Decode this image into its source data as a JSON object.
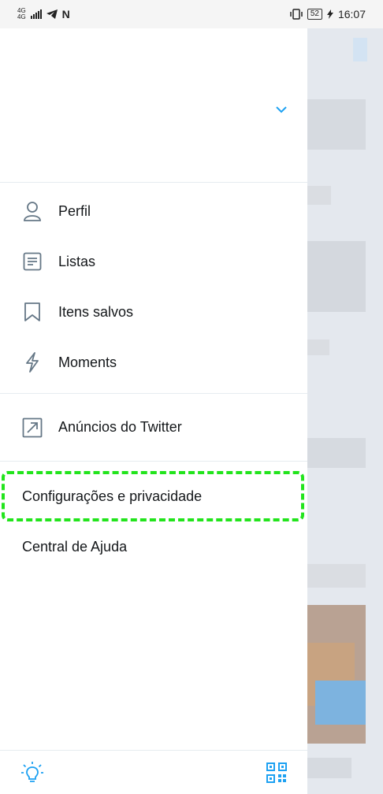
{
  "status_bar": {
    "network": "4G",
    "network2": "4G",
    "carrier_icon": "N",
    "battery": "52",
    "time": "16:07"
  },
  "drawer": {
    "menu_items": [
      {
        "label": "Perfil",
        "icon": "person-icon"
      },
      {
        "label": "Listas",
        "icon": "list-icon"
      },
      {
        "label": "Itens salvos",
        "icon": "bookmark-icon"
      },
      {
        "label": "Moments",
        "icon": "lightning-icon"
      }
    ],
    "ads_item": {
      "label": "Anúncios do Twitter",
      "icon": "external-link-icon"
    },
    "text_items": [
      "Configurações e privacidade",
      "Central de Ajuda"
    ]
  },
  "colors": {
    "accent": "#1da1f2",
    "highlight": "#22e41c",
    "icon_gray": "#657786"
  }
}
